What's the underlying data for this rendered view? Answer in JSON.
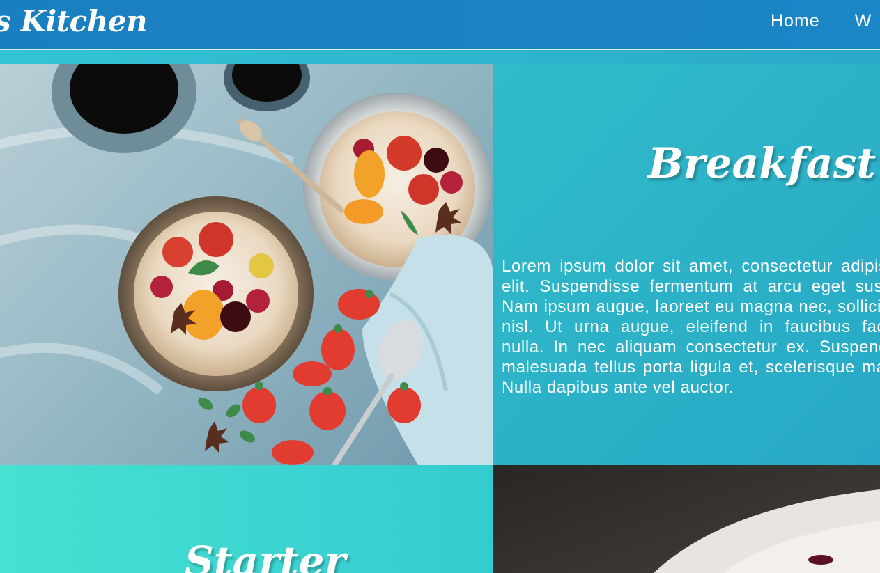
{
  "header": {
    "brand": "s Kitchen",
    "nav": [
      "Home",
      "W"
    ]
  },
  "breakfast": {
    "title": "Breakfast",
    "body": "Lorem ipsum dolor sit amet, consectetur adipiscing elit. Suspendisse fermentum at arcu eget suscipit. Nam ipsum augue, laoreet eu magna nec, sollicitudin nisl. Ut urna augue, eleifend in faucibus facilisis nulla. In nec aliquam consectetur ex. Suspendisse malesuada tellus porta ligula et, scelerisque mauris. Nulla dapibus ante vel auctor.",
    "image_alt": "breakfast-bowls-photo"
  },
  "starter": {
    "title": "Starter"
  },
  "colors": {
    "header": "#1a80c1",
    "panel": "#29a8c6",
    "starter_panel": "#45e2d2"
  }
}
